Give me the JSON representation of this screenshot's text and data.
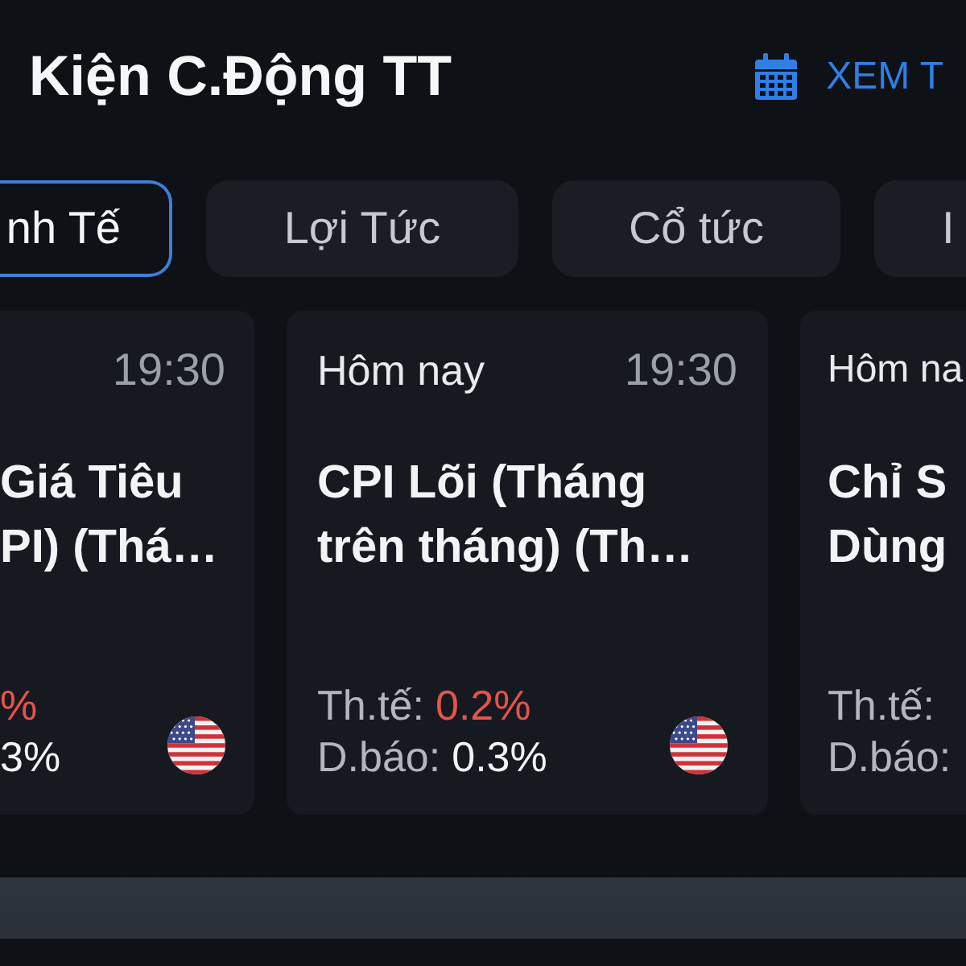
{
  "header": {
    "title": "Kiện C.Động TT",
    "link": "XEM T"
  },
  "tabs": [
    {
      "label": "nh Tế",
      "selected": true
    },
    {
      "label": "Lợi Tức",
      "selected": false
    },
    {
      "label": "Cổ tức",
      "selected": false
    },
    {
      "label": "I",
      "selected": false
    }
  ],
  "events": [
    {
      "kind": "cut-left",
      "time": "19:30",
      "title_lines": [
        "Giá Tiêu",
        "PI) (Thá…"
      ],
      "actual": "%",
      "forecast": "3%"
    },
    {
      "kind": "full",
      "day": "Hôm nay",
      "time": "19:30",
      "title_lines": [
        "CPI Lõi (Tháng",
        "trên tháng) (Th…"
      ],
      "actual_label": "Th.tế:",
      "actual": "0.2%",
      "forecast_label": "D.báo:",
      "forecast": "0.3%"
    },
    {
      "kind": "cut-right",
      "day": "Hôm na",
      "title_lines": [
        "Chỉ S",
        "Dùng"
      ],
      "actual_label": "Th.tế:",
      "forecast_label": "D.báo:"
    }
  ]
}
